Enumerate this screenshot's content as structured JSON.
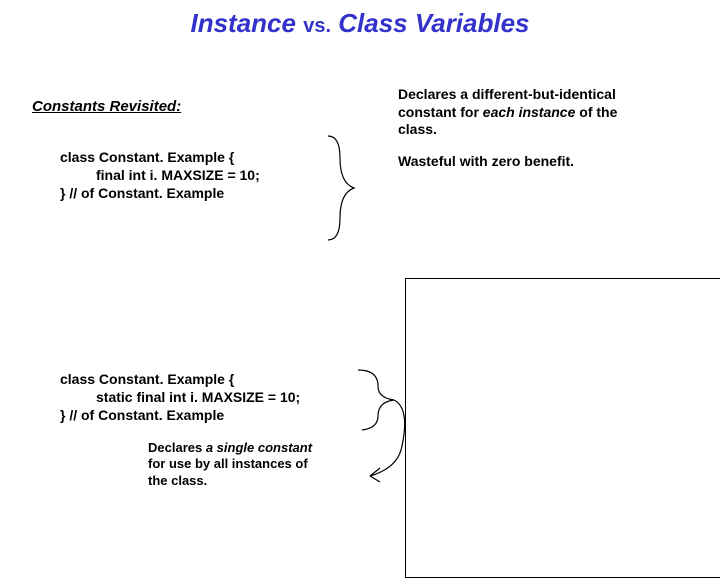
{
  "title": {
    "left": "Instance",
    "vs": "vs.",
    "right": "Class Variables"
  },
  "subheading": "Constants Revisited:",
  "code1": {
    "l1": "class Constant. Example  {",
    "l2": "final int i. MAXSIZE = 10;",
    "l3": "} // of Constant. Example"
  },
  "note_top": {
    "p1a": "Declares a different-but-identical constant for ",
    "p1b": "each instance",
    "p1c": " of the class.",
    "p2": "Wasteful with zero benefit."
  },
  "code2": {
    "l1": "class Constant. Example  {",
    "l2": "static final int i. MAXSIZE = 10;",
    "l3": "} // of Constant. Example"
  },
  "note_bottom": {
    "a": "Declares ",
    "b": "a single constant",
    "c": " for use by all instances of the class."
  }
}
